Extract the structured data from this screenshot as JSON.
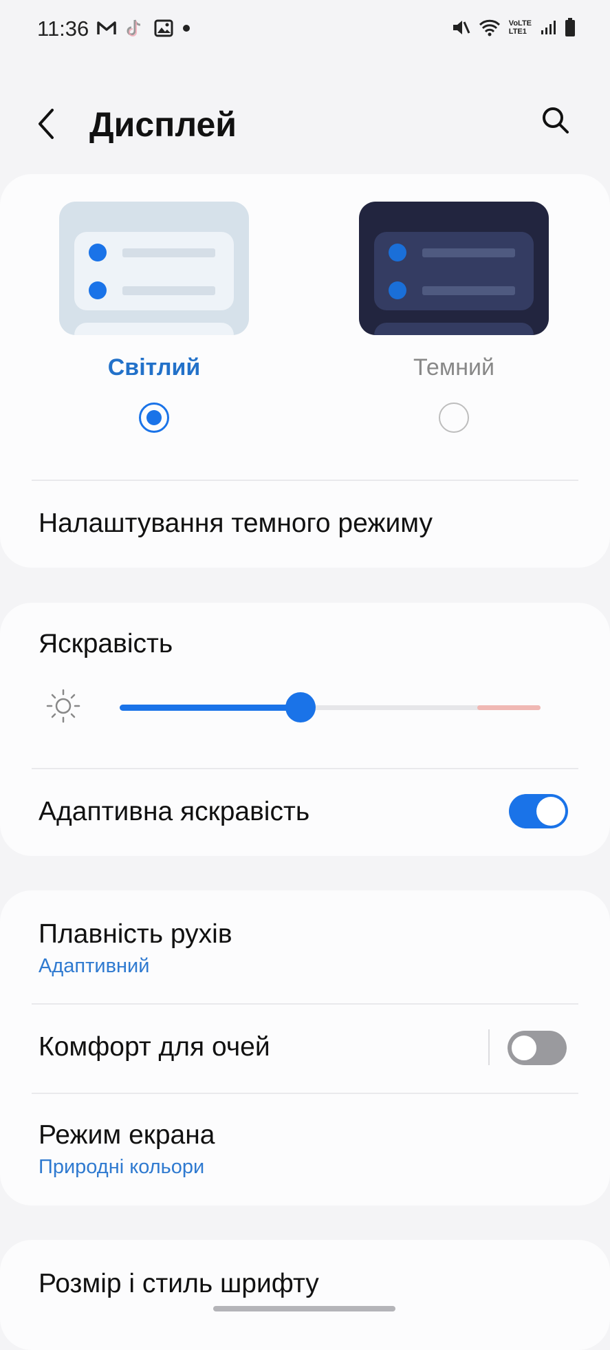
{
  "status_bar": {
    "time": "11:36",
    "notification_icons": [
      "gmail-icon",
      "tiktok-icon",
      "gallery-icon",
      "more-notifications-dot"
    ],
    "system_icons": [
      "mute-icon",
      "wifi-icon",
      "volte-lte-icon",
      "signal-icon",
      "battery-icon"
    ],
    "volte_text": "VoLTE",
    "lte_text": "LTE1"
  },
  "header": {
    "title": "Дисплей",
    "back_icon": "back-arrow-icon",
    "search_icon": "search-icon"
  },
  "theme_card": {
    "light_label": "Світлий",
    "dark_label": "Темний",
    "selected": "light",
    "dark_mode_settings_label": "Налаштування темного режиму"
  },
  "brightness_card": {
    "title": "Яскравість",
    "icon": "sun-icon",
    "level_fraction": 0.43,
    "adaptive_label": "Адаптивна яскравість",
    "adaptive_on": true
  },
  "display_card": {
    "motion_title": "Плавність рухів",
    "motion_value": "Адаптивний",
    "eye_comfort_label": "Комфорт для очей",
    "eye_comfort_on": false,
    "screen_mode_title": "Режим екрана",
    "screen_mode_value": "Природні кольори"
  },
  "font_card": {
    "title": "Розмір і стиль шрифту"
  },
  "colors": {
    "accent": "#1a73e8",
    "sub_text": "#2f7ad0",
    "toggle_off": "#9a9a9e",
    "background": "#f4f4f6"
  }
}
